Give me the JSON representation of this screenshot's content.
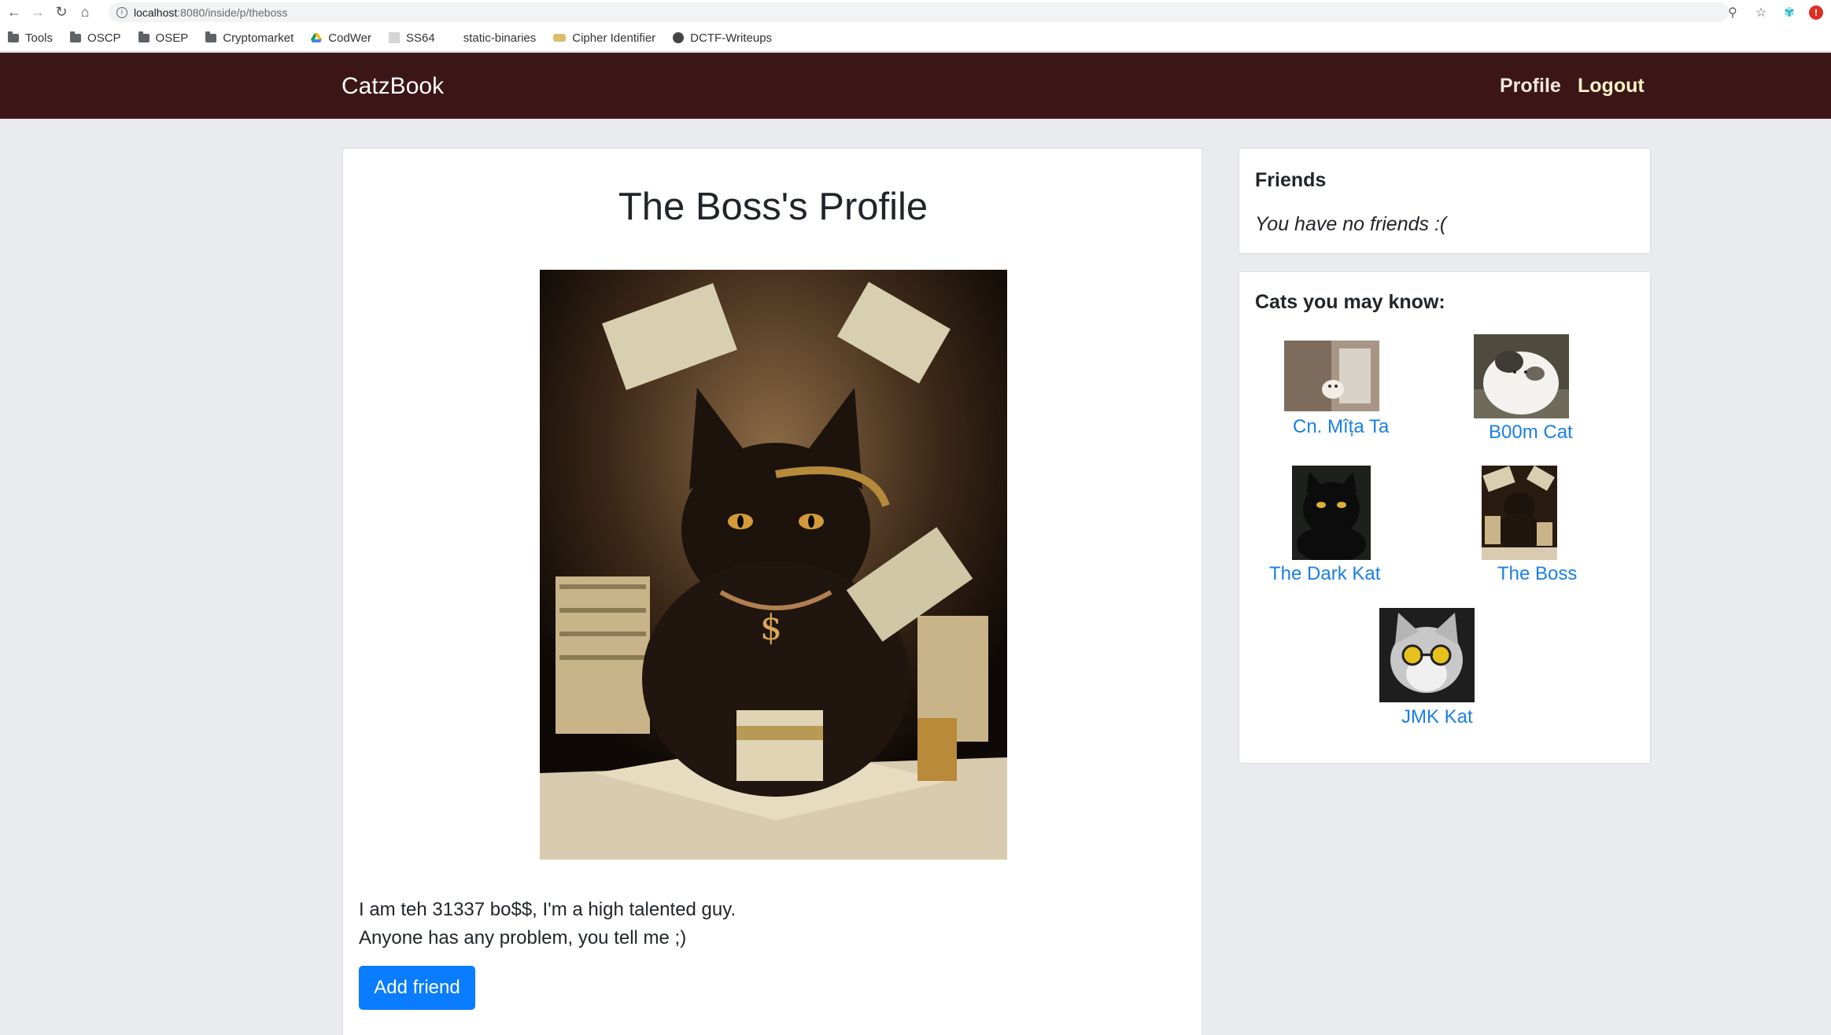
{
  "browser": {
    "url_host": "localhost",
    "url_path": ":8080/inside/p/theboss",
    "bookmarks": [
      {
        "label": "Tools",
        "icon": "folder-icon"
      },
      {
        "label": "OSCP",
        "icon": "folder-icon"
      },
      {
        "label": "OSEP",
        "icon": "folder-icon"
      },
      {
        "label": "Cryptomarket",
        "icon": "folder-icon"
      },
      {
        "label": "CodWer",
        "icon": "google-drive-icon"
      },
      {
        "label": "SS64",
        "icon": "page-icon"
      },
      {
        "label": "static-binaries",
        "icon": "none"
      },
      {
        "label": "Cipher Identifier",
        "icon": "coin-icon"
      },
      {
        "label": "DCTF-Writeups",
        "icon": "globe-icon"
      }
    ]
  },
  "navbar": {
    "brand": "CatzBook",
    "profile_label": "Profile",
    "logout_label": "Logout",
    "background": "#3c1617"
  },
  "profile": {
    "title": "The Boss's Profile",
    "bio_line1": "I am teh 31337 bo$$, I'm a high talented guy.",
    "bio_line2": "Anyone has any problem, you tell me ;)",
    "add_friend_label": "Add friend"
  },
  "friends": {
    "title": "Friends",
    "empty_text": "You have no friends :("
  },
  "suggestions": {
    "title": "Cats you may know:",
    "cats": [
      {
        "name": "Cn. Mîța Ta"
      },
      {
        "name": "B00m Cat"
      },
      {
        "name": "The Dark Kat"
      },
      {
        "name": "The Boss"
      },
      {
        "name": "JMK Kat"
      }
    ]
  },
  "colors": {
    "accent": "#0a7cff",
    "link": "#1a7ee6"
  }
}
